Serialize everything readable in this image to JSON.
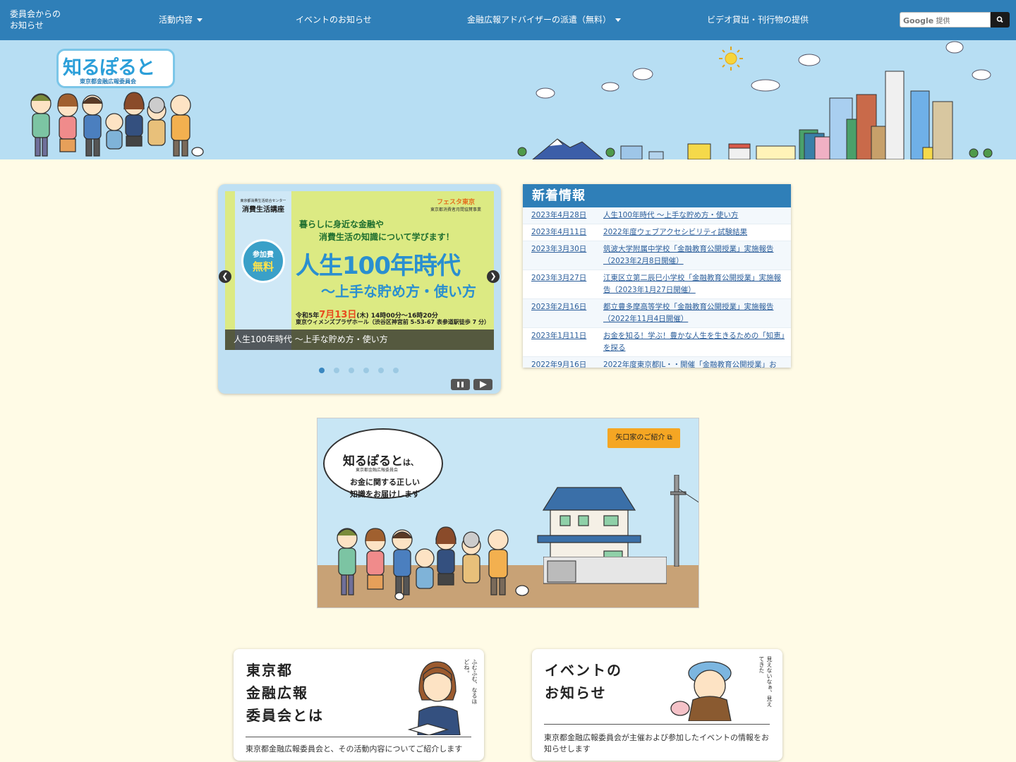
{
  "nav": {
    "items": [
      {
        "label": "委員会からの\nお知らせ",
        "caret": false
      },
      {
        "label": "活動内容",
        "caret": true
      },
      {
        "label": "イベントのお知らせ",
        "caret": false
      },
      {
        "label": "金融広報アドバイザーの派遣（無料）",
        "caret": true
      },
      {
        "label": "ビデオ貸出・刊行物の提供",
        "caret": false
      }
    ],
    "search_placeholder": "提供",
    "search_brand": "Google"
  },
  "logo": {
    "main": "知るぽると",
    "sub": "東京都金融広報委員会"
  },
  "carousel": {
    "slide": {
      "org_small": "東京都消費生活総合センター",
      "org": "消費生活講座",
      "free_a": "参加費",
      "free_b": "無料",
      "sub1": "暮らしに身近な金融や",
      "sub2": "消費生活の知識について学びます！",
      "title": "人生100年時代",
      "title2": "〜上手な貯め方・使い方",
      "fes_brand": "フェスタ東京",
      "fes_note": "東京都消費者月間協賛事業",
      "date_prefix": "令和5年",
      "date_main": "7月13日",
      "date_suffix": "(木) 14時00分〜16時20分",
      "place": "東京ウィメンズプラザホール（渋谷区神宮前 5-53-67 表参道駅徒歩 7 分）",
      "caption": "人生100年時代 〜上手な貯め方・使い方"
    },
    "prev_label": "❮",
    "next_label": "❯",
    "dot_count": 6,
    "active_dot": 0
  },
  "news": {
    "heading": "新着情報",
    "items": [
      {
        "date": "2023年4月28日",
        "title": "人生100年時代 〜上手な貯め方・使い方"
      },
      {
        "date": "2023年4月11日",
        "title": "2022年度ウェブアクセシビリティ試験結果"
      },
      {
        "date": "2023年3月30日",
        "title": "筑波大学附属中学校「金融教育公開授業」実施報告（2023年2月8日開催）"
      },
      {
        "date": "2023年3月27日",
        "title": "江東区立第二辰巳小学校「金融教育公開授業」実施報告（2023年1月27日開催）"
      },
      {
        "date": "2023年2月16日",
        "title": "都立豊多摩高等学校「金融教育公開授業」実施報告（2022年11月4日開催）"
      },
      {
        "date": "2023年1月11日",
        "title": "お金を知る！学ぶ！豊かな人生を生きるための「知恵」を探る"
      },
      {
        "date": "2022年9月16日",
        "title": "2022年度東京都JL・・開催「金融教育公開授業」お"
      }
    ]
  },
  "banner": {
    "bubble_brand": "知るぽると",
    "bubble_brand_suffix": "は、",
    "bubble_sub": "東京都金融広報委員会",
    "bubble_l1": "お金に関する正しい",
    "bubble_l2": "知識をお届けします",
    "yaguchi_label": "矢口家のご紹介"
  },
  "cards": [
    {
      "title_lines": [
        "東京都",
        "金融広報",
        "委員会とは"
      ],
      "desc": "東京都金融広報委員会と、その活動内容についてご紹介します",
      "doodle": "ふむふむ、なるほどね。"
    },
    {
      "title_lines": [
        "イベントの",
        "お知らせ"
      ],
      "desc": "東京都金融広報委員会が主催および参加したイベントの情報をお知らせします",
      "doodle": "見えないなぁ、見えてきた"
    }
  ],
  "colors": {
    "nav": "#2f7fb8",
    "page_bg": "#fffbe6",
    "sky": "#b7def3",
    "accent_orange": "#f5a623"
  }
}
